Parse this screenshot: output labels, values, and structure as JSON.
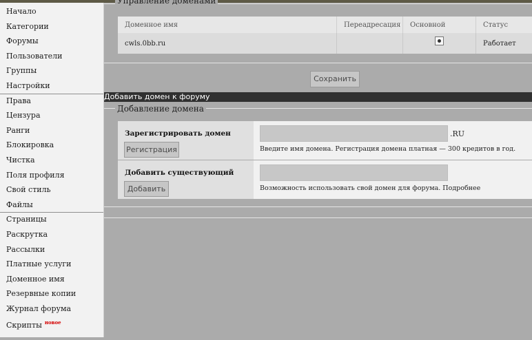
{
  "sidebar": {
    "groups": [
      [
        "Начало",
        "Категории",
        "Форумы",
        "Пользователи",
        "Группы",
        "Настройки"
      ],
      [
        "Права",
        "Цензура",
        "Ранги",
        "Блокировка",
        "Чистка",
        "Поля профиля",
        "Свой стиль",
        "Файлы"
      ],
      [
        "Страницы",
        "Раскрутка",
        "Рассылки",
        "Платные услуги",
        "Доменное имя",
        "Резервные копии",
        "Журнал форума",
        "Скрипты"
      ]
    ],
    "new_badge": "новое"
  },
  "domains": {
    "legend": "Управление доменами",
    "columns": [
      "Доменное имя",
      "Переадресация",
      "Основной",
      "Статус"
    ],
    "rows": [
      {
        "domain": "cwls.0bb.ru",
        "redirect": "",
        "primary": true,
        "status": "Работает"
      }
    ],
    "save_label": "Сохранить"
  },
  "add_domain": {
    "bar_title": "Добавить домен к форуму",
    "legend": "Добавление домена",
    "register": {
      "label": "Зарегистрировать домен",
      "button": "Регистрация",
      "suffix": ".RU",
      "hint": "Введите имя домена. Регистрация домена платная — 300 кредитов в год.",
      "value": ""
    },
    "existing": {
      "label": "Добавить существующий",
      "button": "Добавить",
      "hint": "Возможность использовать свой домен для форума. Подробнее",
      "value": ""
    }
  }
}
